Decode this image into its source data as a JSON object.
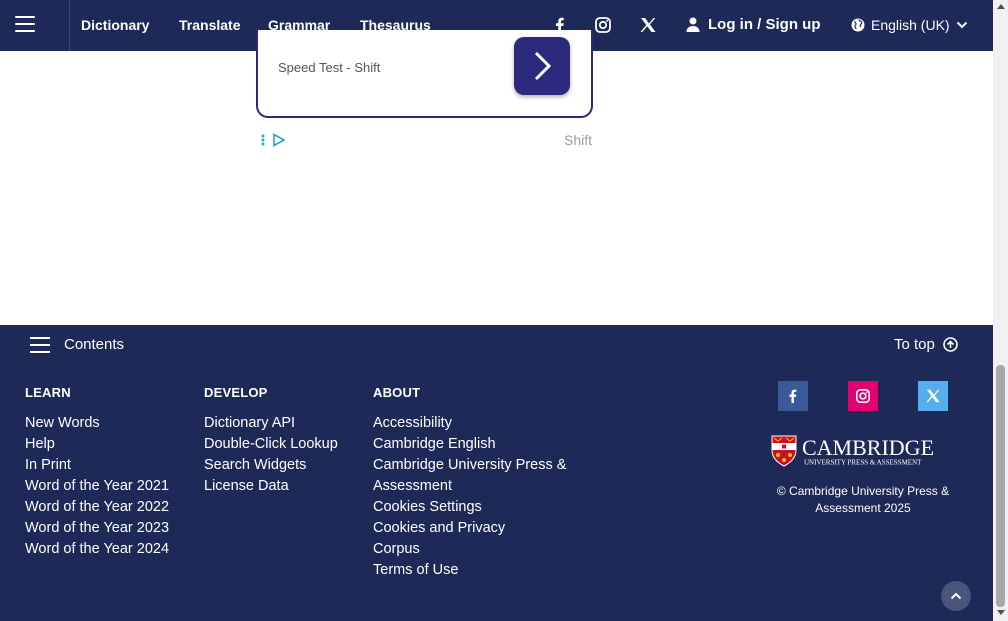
{
  "nav": {
    "links": [
      "Dictionary",
      "Translate",
      "Grammar",
      "Thesaurus"
    ],
    "login_label": "Log in / Sign up",
    "language": "English (UK)"
  },
  "ad": {
    "text": "Speed Test - Shift",
    "brand": "Shift"
  },
  "footer": {
    "contents_label": "Contents",
    "to_top_label": "To top",
    "columns": [
      {
        "heading": "LEARN",
        "links": [
          "New Words",
          "Help",
          "In Print",
          "Word of the Year 2021",
          "Word of the Year 2022",
          "Word of the Year 2023",
          "Word of the Year 2024"
        ]
      },
      {
        "heading": "DEVELOP",
        "links": [
          "Dictionary API",
          "Double-Click Lookup",
          "Search Widgets",
          "License Data"
        ]
      },
      {
        "heading": "ABOUT",
        "links": [
          "Accessibility",
          "Cambridge English",
          "Cambridge University Press & Assessment",
          "Cookies Settings",
          "Cookies and Privacy",
          "Corpus",
          "Terms of Use"
        ]
      }
    ],
    "logo_name": "CAMBRIDGE",
    "logo_sub": "UNIVERSITY PRESS & ASSESSMENT",
    "copyright": "© Cambridge University Press & Assessment 2025"
  },
  "colors": {
    "navy": "#1d2a57",
    "facebook": "#3b5998",
    "instagram": "#e4006f",
    "x": "#55acee"
  }
}
